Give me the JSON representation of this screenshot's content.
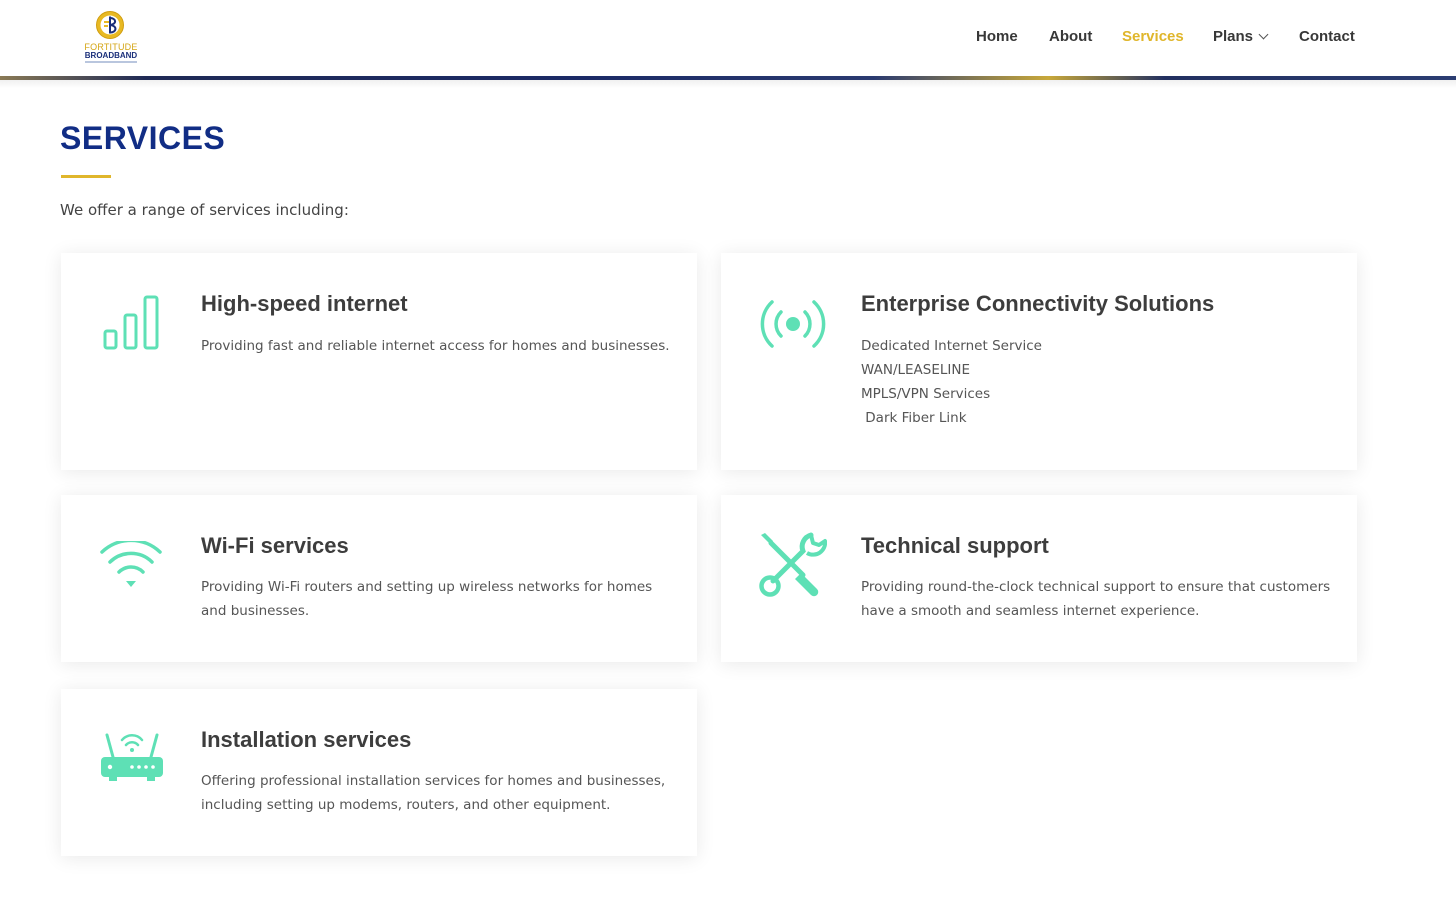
{
  "brand": {
    "name_line1": "FORTITUDE",
    "name_line2": "BROADBAND",
    "logo_colors": {
      "gold": "#e8b923",
      "navy": "#1a2f7a"
    }
  },
  "nav": {
    "items": [
      {
        "label": "Home",
        "active": false
      },
      {
        "label": "About",
        "active": false
      },
      {
        "label": "Services",
        "active": true
      },
      {
        "label": "Plans",
        "active": false,
        "has_dropdown": true
      },
      {
        "label": "Contact",
        "active": false
      }
    ]
  },
  "page": {
    "title": "SERVICES",
    "intro": "We offer a range of services including:"
  },
  "colors": {
    "accent": "#e0b62b",
    "title": "#112d85",
    "icon": "#5ee0b5"
  },
  "services": [
    {
      "icon": "signal-bars-icon",
      "title": "High-speed internet",
      "description": "Providing fast and reliable internet access for homes and businesses."
    },
    {
      "icon": "broadcast-icon",
      "title": "Enterprise Connectivity Solutions",
      "items": [
        "Dedicated Internet Service",
        "WAN/LEASELINE",
        "MPLS/VPN Services",
        " Dark Fiber Link"
      ]
    },
    {
      "icon": "wifi-icon",
      "title": "Wi-Fi services",
      "description": "Providing Wi-Fi routers and setting up wireless networks for homes and businesses."
    },
    {
      "icon": "tools-icon",
      "title": "Technical support",
      "description": "Providing round-the-clock technical support to ensure that customers have a smooth and seamless internet experience."
    },
    {
      "icon": "router-icon",
      "title": "Installation services",
      "description": "Offering professional installation services for homes and businesses, including setting up modems, routers, and other equipment."
    }
  ]
}
